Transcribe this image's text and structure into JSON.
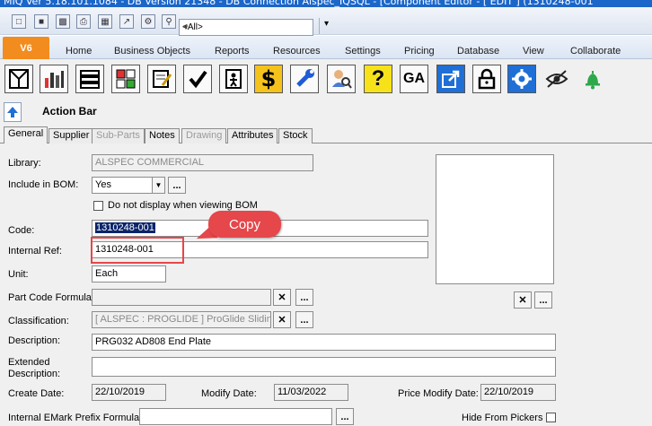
{
  "window": {
    "title": "MIQ Ver 5.18.101.1084 - DB Version 21348 - DB Connection Alspec_IQSQL - [Component Editor - [ EDIT ] (1310248-001"
  },
  "quick_access": {
    "filter_value": "<All>",
    "more_label": "»"
  },
  "ribbon": {
    "version_tab": "V6",
    "tabs": [
      "Home",
      "Business Objects",
      "Reports",
      "Resources",
      "Settings",
      "Pricing",
      "Database",
      "View",
      "Collaborate"
    ]
  },
  "toolbar": {
    "dollar_label": "$",
    "question_label": "?",
    "ga_label": "GA"
  },
  "action_bar": {
    "title": "Action Bar"
  },
  "form_tabs": [
    "General",
    "Supplier",
    "Sub-Parts",
    "Notes",
    "Drawing",
    "Attributes",
    "Stock"
  ],
  "form": {
    "library_label": "Library:",
    "library_value": "ALSPEC COMMERCIAL",
    "include_bom_label": "Include in BOM:",
    "include_bom_value": "Yes",
    "no_display_label": "Do not display when viewing BOM",
    "code_label": "Code:",
    "code_value": "1310248-001",
    "internal_ref_label": "Internal Ref:",
    "internal_ref_value": "1310248-001",
    "unit_label": "Unit:",
    "unit_value": "Each",
    "part_code_formula_label": "Part Code Formula:",
    "classification_label": "Classification:",
    "classification_value": "[ ALSPEC : PROGLIDE ]   ProGlide Sliding",
    "description_label": "Description:",
    "description_value": "PRG032 AD808 End Plate",
    "extended_label_1": "Extended",
    "extended_label_2": "Description:",
    "create_date_label": "Create Date:",
    "create_date_value": "22/10/2019",
    "modify_date_label": "Modify Date:",
    "modify_date_value": "11/03/2022",
    "price_modify_label": "Price Modify Date:",
    "price_modify_value": "22/10/2019",
    "emark_label": "Internal EMark Prefix Formula:",
    "hide_pickers_label": "Hide From Pickers",
    "ellipsis": "...",
    "clear_x": "✕"
  },
  "annotation": {
    "callout_text": "Copy",
    "color": "#e5474b"
  }
}
